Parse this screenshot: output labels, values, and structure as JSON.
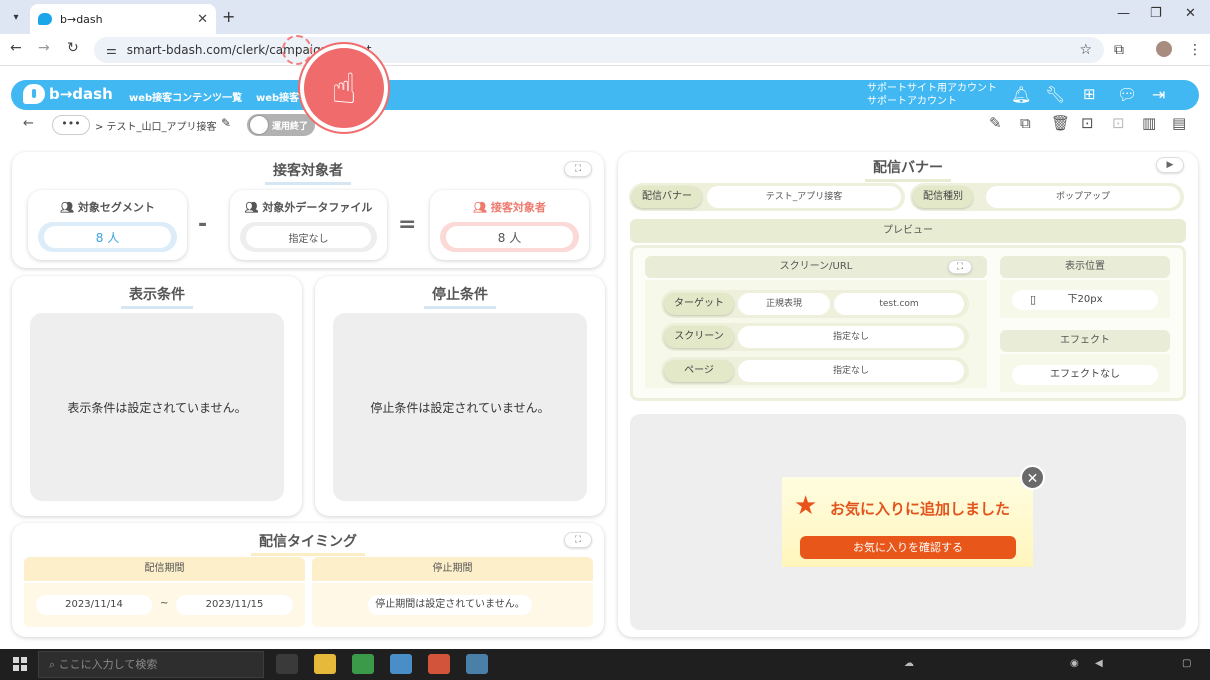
{
  "browser": {
    "tab_title": "b→dash",
    "url": "smart-bdash.com/clerk/campaign/77/det",
    "tab_close": "✕",
    "new_tab": "+"
  },
  "header": {
    "logo": "b→dash",
    "nav": [
      "web接客コンテンツ一覧",
      "web接客"
    ],
    "account_line1": "サポートサイト用アカウント",
    "account_line2": "サポートアカウント"
  },
  "breadcrumb": {
    "dots": "•••",
    "path": "> テスト_山口_アプリ接客",
    "toggle_label": "運用終了"
  },
  "target": {
    "title": "接客対象者",
    "segment_label": "対象セグメント",
    "segment_value": "8 人",
    "exclude_label": "対象外データファイル",
    "exclude_value": "指定なし",
    "result_label": "接客対象者",
    "result_value": "8 人",
    "minus": "-",
    "equals": "="
  },
  "display_cond": {
    "title": "表示条件",
    "empty": "表示条件は設定されていません。"
  },
  "stop_cond": {
    "title": "停止条件",
    "empty": "停止条件は設定されていません。"
  },
  "timing": {
    "title": "配信タイミング",
    "period_label": "配信期間",
    "start": "2023/11/14",
    "tilde": "~",
    "end": "2023/11/15",
    "stop_label": "停止期間",
    "stop_value": "停止期間は設定されていません。"
  },
  "banner": {
    "title": "配信バナー",
    "banner_label": "配信バナー",
    "banner_value": "テスト_アプリ接客",
    "type_label": "配信種別",
    "type_value": "ポップアップ",
    "preview_label": "プレビュー",
    "screen_url_label": "スクリーン/URL",
    "target_label": "ターゲット",
    "target_match": "正規表現",
    "target_value": "test.com",
    "screen_label": "スクリーン",
    "screen_value": "指定なし",
    "page_label": "ページ",
    "page_value": "指定なし",
    "position_label": "表示位置",
    "position_value": "下20px",
    "effect_label": "エフェクト",
    "effect_value": "エフェクトなし"
  },
  "popup": {
    "message": "お気に入りに追加しました",
    "button": "お気に入りを確認する",
    "close": "✕"
  },
  "taskbar": {
    "search_placeholder": "ここに入力して検索"
  },
  "colors": {
    "header_blue": "#41b8f1",
    "accent_orange": "#e8561a",
    "segment_blue": "#dcecf8",
    "result_pink": "#fbd9d6",
    "timing_yellow": "#fcefc9",
    "banner_green": "#e7ecd2"
  }
}
